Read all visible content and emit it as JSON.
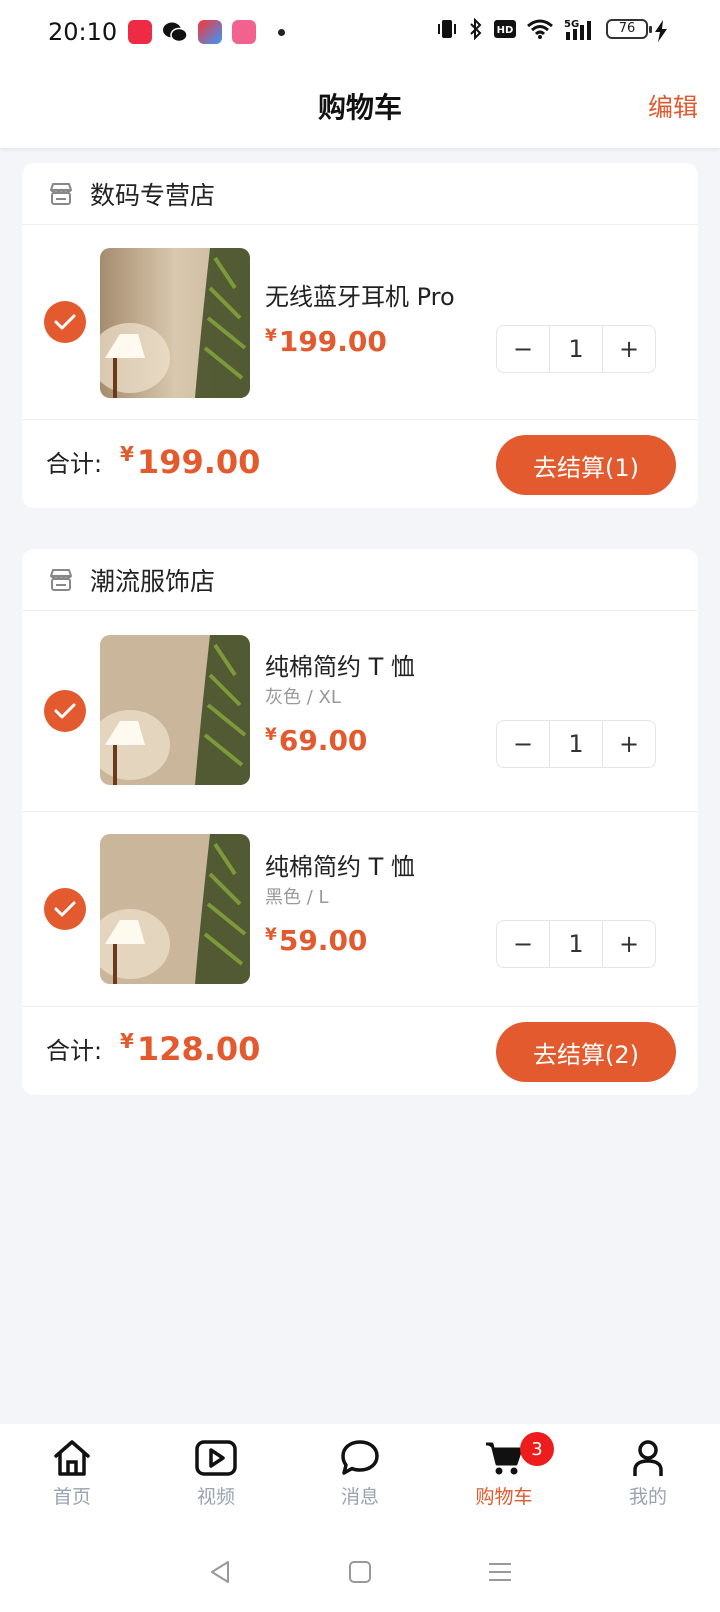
{
  "status": {
    "time": "20:10",
    "battery": "76",
    "network": "5G"
  },
  "header": {
    "title": "购物车",
    "edit": "编辑"
  },
  "shops": [
    {
      "name": "数码专营店",
      "items": [
        {
          "title": "无线蓝牙耳机 Pro",
          "spec": "",
          "price": "199.00",
          "qty": "1",
          "checked": true
        }
      ],
      "total_label": "合计:",
      "total": "199.00",
      "checkout": "去结算(1)"
    },
    {
      "name": "潮流服饰店",
      "items": [
        {
          "title": "纯棉简约 T 恤",
          "spec": "灰色 / XL",
          "price": "69.00",
          "qty": "1",
          "checked": true
        },
        {
          "title": "纯棉简约 T 恤",
          "spec": "黑色 / L",
          "price": "59.00",
          "qty": "1",
          "checked": true
        }
      ],
      "total_label": "合计:",
      "total": "128.00",
      "checkout": "去结算(2)"
    }
  ],
  "currency": "¥",
  "stepper": {
    "minus": "−",
    "plus": "+"
  },
  "nav": {
    "tabs": [
      {
        "label": "首页",
        "icon": "home-icon"
      },
      {
        "label": "视频",
        "icon": "video-icon"
      },
      {
        "label": "消息",
        "icon": "message-icon"
      },
      {
        "label": "购物车",
        "icon": "cart-icon",
        "active": true
      },
      {
        "label": "我的",
        "icon": "user-icon"
      }
    ],
    "cart_badge": "3"
  },
  "colors": {
    "accent": "#e25a2e",
    "badge": "#ee1d1d",
    "background": "#f4f5f9"
  }
}
